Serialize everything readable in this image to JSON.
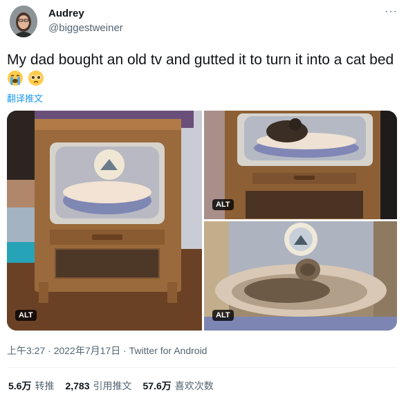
{
  "tweet": {
    "display_name": "Audrey",
    "handle": "@biggestweiner",
    "more_label": "···",
    "text": "My dad bought an old tv and gutted it to turn it into a cat bed",
    "emojis": [
      "loudly-crying-face",
      "pleading-face"
    ],
    "translate_label": "翻译推文",
    "alt_label": "ALT",
    "meta": "上午3:27 · 2022年7月17日 · Twitter for Android",
    "stats": [
      {
        "count": "5.6万",
        "label": "转推"
      },
      {
        "count": "2,783",
        "label": "引用推文"
      },
      {
        "count": "57.6万",
        "label": "喜欢次数"
      }
    ]
  },
  "colors": {
    "link": "#1d9bf0",
    "secondary": "#536471",
    "primary_text": "#0f1419"
  }
}
